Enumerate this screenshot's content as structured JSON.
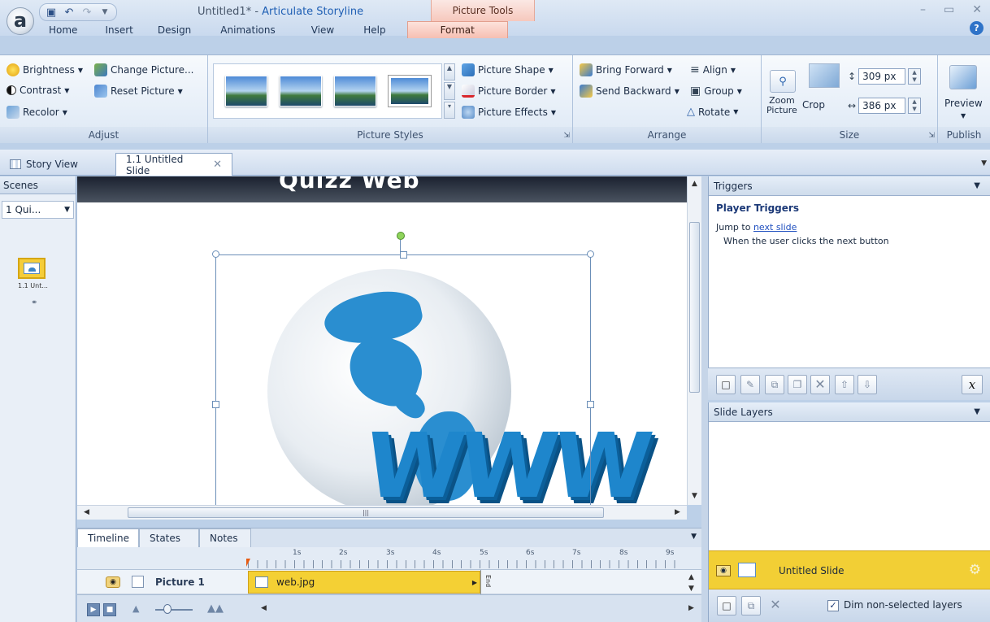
{
  "window": {
    "title_doc": "Untitled1* - ",
    "title_app": "Articulate Storyline",
    "contextual_tab_group": "Picture Tools",
    "app_button": "a"
  },
  "ribbon_tabs": [
    "Home",
    "Insert",
    "Design",
    "Animations",
    "View",
    "Help",
    "Format"
  ],
  "active_tab": "Format",
  "ribbon": {
    "adjust": {
      "label": "Adjust",
      "brightness": "Brightness",
      "contrast": "Contrast",
      "recolor": "Recolor",
      "change_picture": "Change Picture...",
      "reset_picture": "Reset Picture"
    },
    "picture_styles": {
      "label": "Picture Styles",
      "picture_shape": "Picture Shape",
      "picture_border": "Picture Border",
      "picture_effects": "Picture Effects"
    },
    "arrange": {
      "label": "Arrange",
      "bring_forward": "Bring Forward",
      "send_backward": "Send Backward",
      "align": "Align",
      "group": "Group",
      "rotate": "Rotate"
    },
    "size": {
      "label": "Size",
      "zoom_picture_1": "Zoom",
      "zoom_picture_2": "Picture",
      "crop": "Crop",
      "height": "309 px",
      "width": "386 px"
    },
    "publish": {
      "label": "Publish",
      "preview": "Preview"
    }
  },
  "doc_tabs": {
    "story_view": "Story View",
    "slide_tab": "1.1 Untitled Slide"
  },
  "scenes": {
    "header": "Scenes",
    "selected": "1 Qui...",
    "slide_label": "1.1 Unt..."
  },
  "slide": {
    "title": "Quizz Web",
    "www_text": "WWW"
  },
  "timeline": {
    "tabs": [
      "Timeline",
      "States",
      "Notes"
    ],
    "ticks": [
      "1s",
      "2s",
      "3s",
      "4s",
      "5s",
      "6s",
      "7s",
      "8s",
      "9s"
    ],
    "row_name": "Picture 1",
    "bar_label": "web.jpg",
    "end_label": "End"
  },
  "triggers": {
    "header": "Triggers",
    "section": "Player Triggers",
    "jump_prefix": "Jump to ",
    "jump_link": "next slide",
    "condition": "When the user clicks the next button",
    "variable_button": "x"
  },
  "layers": {
    "header": "Slide Layers",
    "base_layer": "Untitled Slide",
    "dim_label": "Dim non-selected layers",
    "dim_checked": true
  },
  "colors": {
    "ribbon_accent": "#f6c8bd",
    "selected_layer": "#f2cf35",
    "timeline_bar": "#f4d034",
    "www_blue": "#1e86cc"
  }
}
